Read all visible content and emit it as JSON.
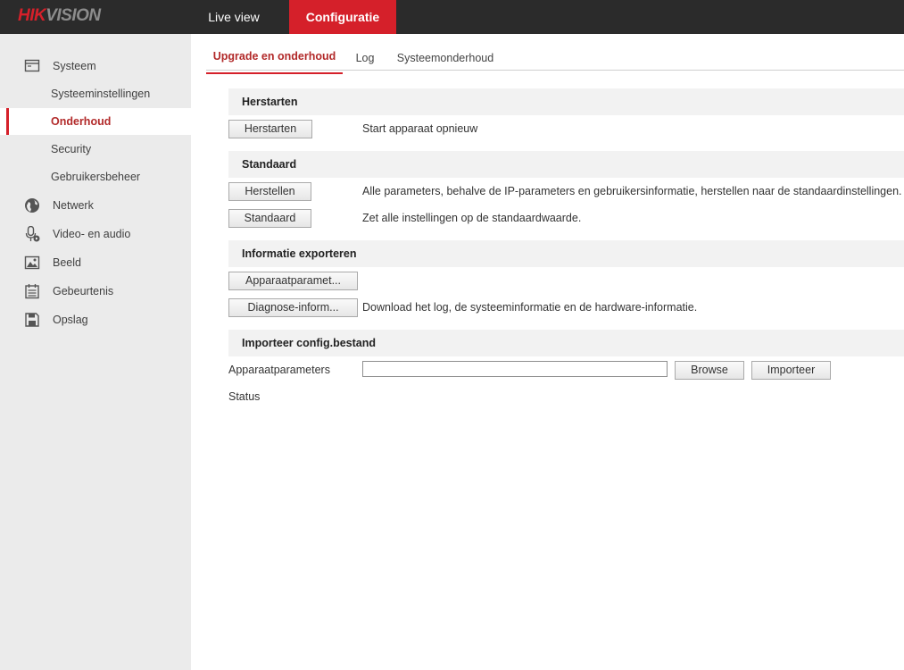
{
  "brand": {
    "logo_part1": "HIK",
    "logo_part2": "VISION"
  },
  "topnav": {
    "live_view": "Live view",
    "configuration": "Configuratie"
  },
  "sidebar": {
    "system": "Systeem",
    "system_items": [
      "Systeeminstellingen",
      "Onderhoud",
      "Security",
      "Gebruikersbeheer"
    ],
    "active_item": "Onderhoud",
    "network": "Netwerk",
    "video_audio": "Video- en audio",
    "image": "Beeld",
    "events": "Gebeurtenis",
    "storage": "Opslag"
  },
  "tabs": [
    "Upgrade en onderhoud",
    "Log",
    "Systeemonderhoud"
  ],
  "active_tab": "Upgrade en onderhoud",
  "restart": {
    "heading": "Herstarten",
    "button": "Herstarten",
    "description": "Start apparaat opnieuw"
  },
  "default": {
    "heading": "Standaard",
    "restore_button": "Herstellen",
    "restore_description": "Alle parameters, behalve de IP-parameters en gebruikersinformatie, herstellen naar de standaardinstellingen.",
    "default_button": "Standaard",
    "default_description": "Zet alle instellingen op de standaardwaarde."
  },
  "export": {
    "heading": "Informatie exporteren",
    "device_params_button": "Apparaatparamet...",
    "diagnose_button": "Diagnose-inform...",
    "diagnose_description": "Download het log, de systeeminformatie en de hardware-informatie."
  },
  "import": {
    "heading": "Importeer config.bestand",
    "device_params_label": "Apparaatparameters",
    "file_value": "",
    "browse_button": "Browse",
    "import_button": "Importeer",
    "status_label": "Status"
  },
  "colors": {
    "brand_red": "#d5202a",
    "topbar": "#2b2b2b",
    "sidebar": "#ebebeb",
    "active_text": "#b22a2a"
  },
  "icons": {
    "system": "window-icon",
    "network": "globe-icon",
    "video_audio": "microphone-icon",
    "image": "picture-icon",
    "events": "calendar-icon",
    "storage": "floppy-disk-icon"
  }
}
